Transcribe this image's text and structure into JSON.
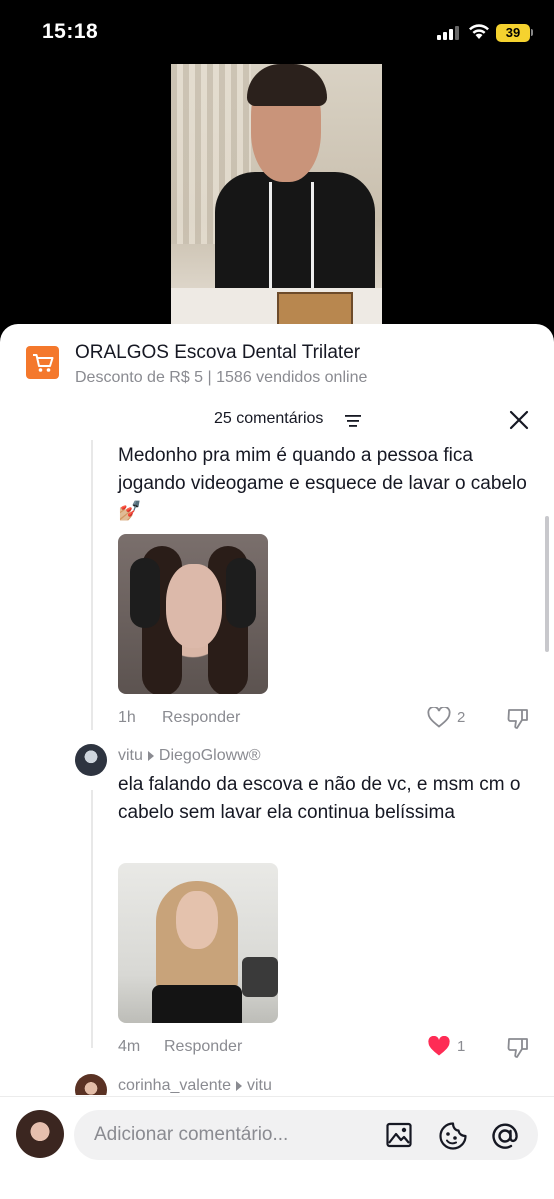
{
  "status_bar": {
    "time": "15:18",
    "battery": "39"
  },
  "product": {
    "title": "ORALGOS Escova Dental Trilater",
    "subtitle": "Desconto de R$ 5 | 1586 vendidos online",
    "icon": "shopping-cart-icon",
    "icon_color": "#f4782c"
  },
  "comments_header": {
    "count_label": "25 comentários",
    "sort_icon": "sort-icon",
    "close_icon": "close-icon"
  },
  "comments": [
    {
      "text": "Medonho pra mim é quando a pessoa fica jogando videogame e esquece de lavar o cabelo 💅🏼",
      "time": "1h",
      "reply_label": "Responder",
      "likes": "2",
      "liked": false
    },
    {
      "username": "vitu",
      "reply_to": "DiegoGloww®",
      "text": "ela falando da escova e não de vc, e msm cm o cabelo sem lavar ela continua belíssima",
      "time": "4m",
      "reply_label": "Responder",
      "likes": "1",
      "liked": true
    },
    {
      "username": "corinha_valente",
      "reply_to": "vitu"
    }
  ],
  "composer": {
    "placeholder": "Adicionar comentário...",
    "icons": [
      "image-icon",
      "emoji-icon",
      "mention-icon"
    ]
  },
  "colors": {
    "like_active": "#fe2c55",
    "text_secondary": "#8a8b91",
    "text_primary": "#161823"
  }
}
